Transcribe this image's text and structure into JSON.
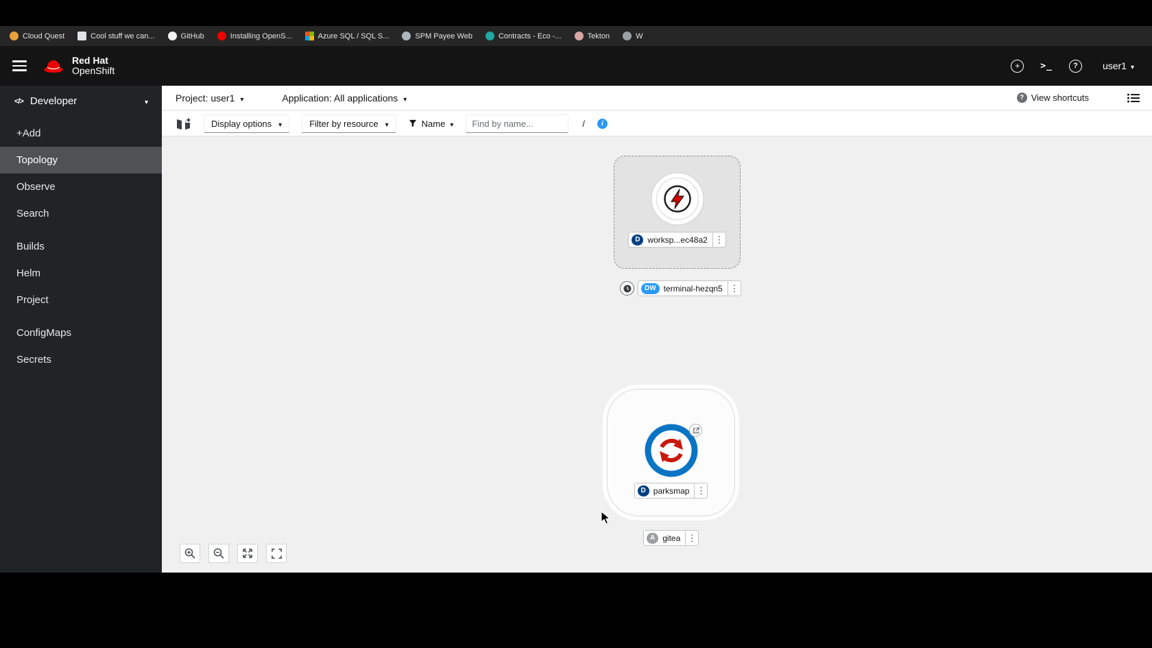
{
  "bookmarks": {
    "items": [
      {
        "label": "Cloud Quest",
        "icon_style": "background:#e8a33d;border-radius:50%"
      },
      {
        "label": "Cool stuff we can...",
        "icon_style": "background:#dfe3e6;border-radius:2px"
      },
      {
        "label": "GitHub",
        "icon_style": "background:#f2f2f2;border-radius:50%"
      },
      {
        "label": "Installing OpenS...",
        "icon_style": "background:#ee0000;border-radius:50%"
      },
      {
        "label": "Azure SQL / SQL S...",
        "icon_style": "background:conic-gradient(#7fba00 0 25%, #ffb900 0 50%, #00a4ef 0 75%, #f25022 0);border-radius:1px"
      },
      {
        "label": "SPM Payee Web",
        "icon_style": "background:#aeb6bd;border-radius:50%"
      },
      {
        "label": "Contracts - Eco -...",
        "icon_style": "background:#1fa7a0;border-radius:50%"
      },
      {
        "label": "Tekton",
        "icon_style": "background:#d8a5a5;border-radius:50%"
      },
      {
        "label": "W",
        "icon_style": "background:#9aa0a6;border-radius:50%"
      }
    ]
  },
  "masthead": {
    "brand_top": "Red Hat",
    "brand_bottom": "OpenShift",
    "username": "user1"
  },
  "sidebar": {
    "perspective": "Developer",
    "items": [
      "+Add",
      "Topology",
      "Observe",
      "Search",
      "Builds",
      "Helm",
      "Project",
      "ConfigMaps",
      "Secrets"
    ]
  },
  "context": {
    "project": "Project: user1",
    "application": "Application: All applications",
    "view_shortcuts": "View shortcuts"
  },
  "toolbar": {
    "display_options": "Display options",
    "filter_by_resource": "Filter by resource",
    "name_filter": "Name",
    "find_placeholder": "Find by name...",
    "shortcut_key": "/"
  },
  "topology": {
    "workspace_node": {
      "badge": "D",
      "label": "worksp...ec48a2"
    },
    "terminal_row": {
      "badge": "DW",
      "label": "terminal-hezqn5"
    },
    "parksmap_node": {
      "badge": "D",
      "label": "parksmap"
    },
    "gitea_row": {
      "badge": "A",
      "label": "gitea"
    }
  },
  "colors": {
    "brand_red": "#ee0000",
    "accent_blue": "#2b9af3",
    "deployment_badge_navy": "#004080",
    "devworkspace_badge_blue": "#2b9af3",
    "selected_nav_gray": "#4f5255"
  }
}
